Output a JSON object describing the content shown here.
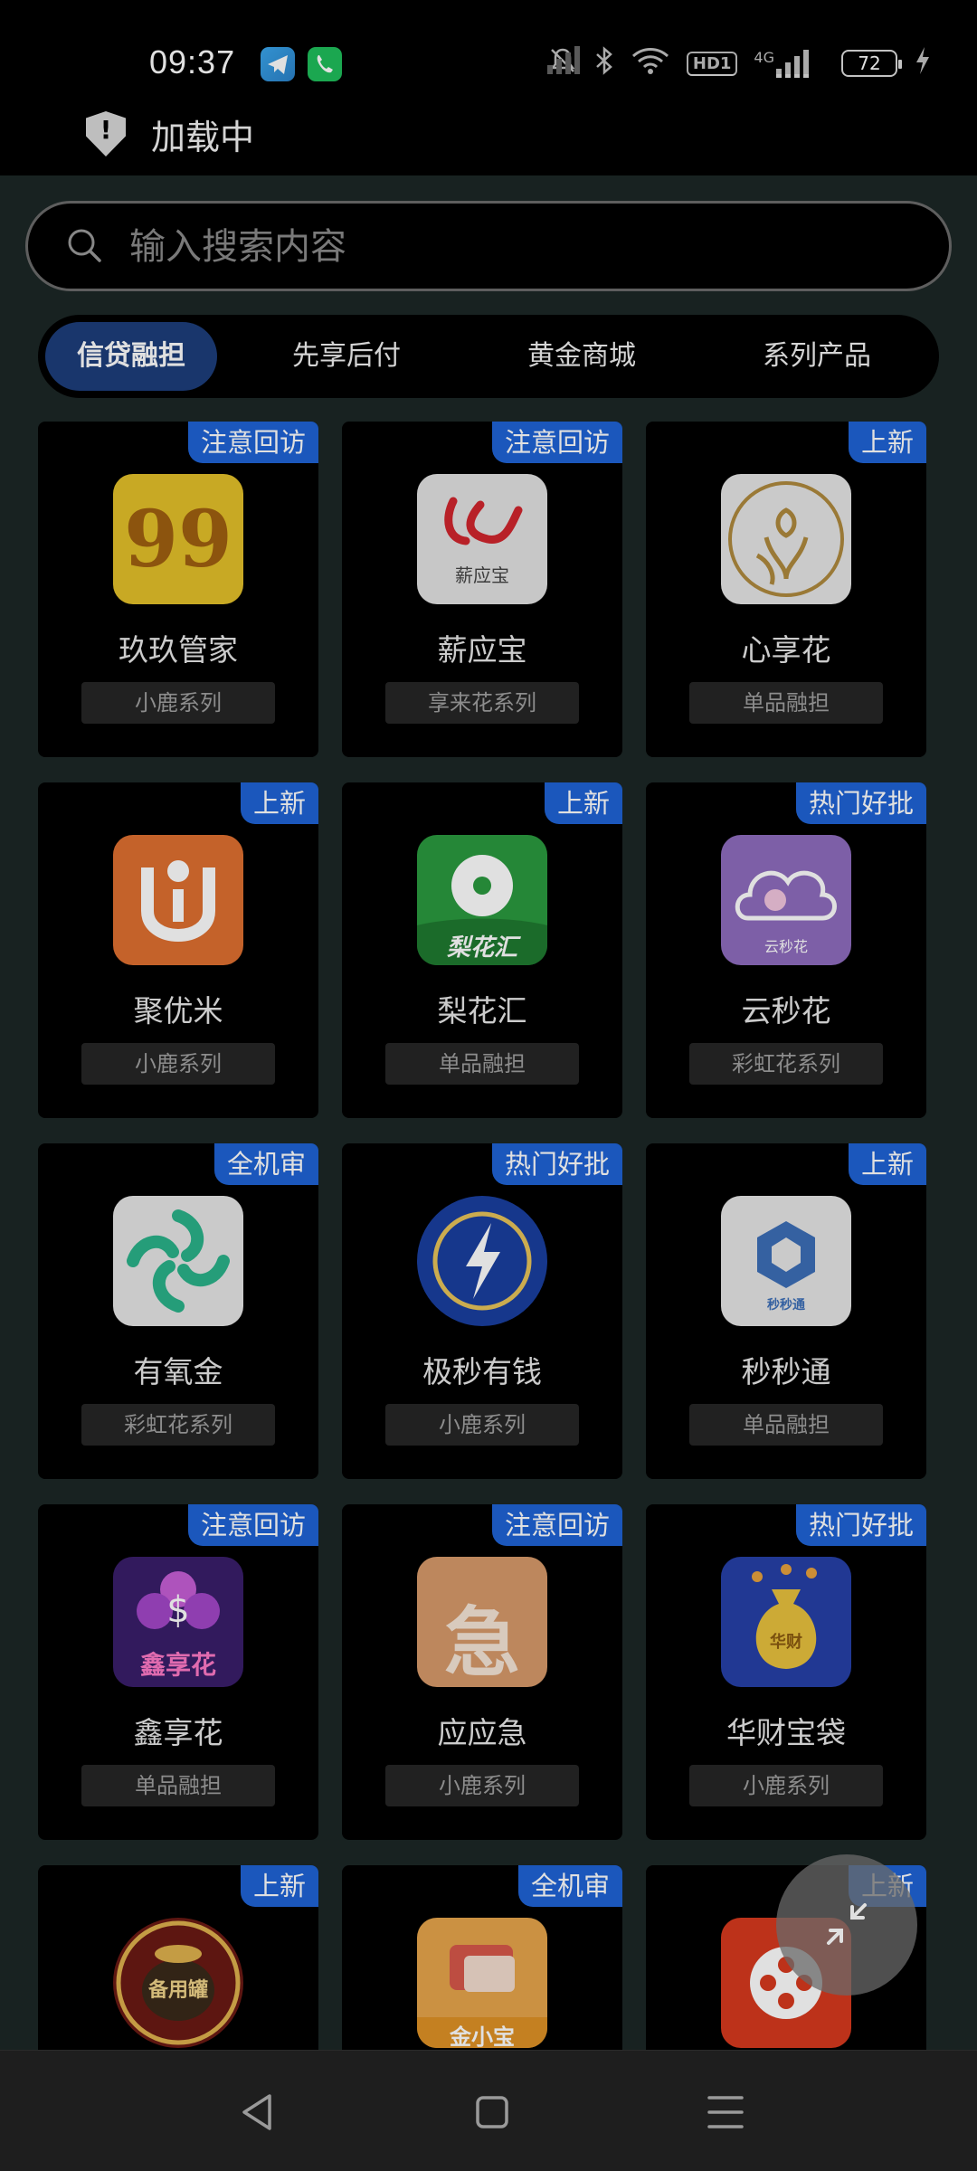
{
  "status_bar": {
    "time": "09:37",
    "network_label": "4G",
    "hd_label": "HD1",
    "battery": "72",
    "icons": [
      "telegram-icon",
      "phone-icon",
      "mute-icon",
      "bluetooth-icon",
      "wifi-icon",
      "hd-icon",
      "signal-icon",
      "signal-icon-2",
      "battery-icon",
      "charging-icon"
    ]
  },
  "page_loading": {
    "text": "加载中",
    "icon": "shield-icon"
  },
  "search": {
    "placeholder": "输入搜索内容",
    "value": ""
  },
  "tabs": [
    {
      "label": "信贷融担",
      "active": true
    },
    {
      "label": "先享后付",
      "active": false
    },
    {
      "label": "黄金商城",
      "active": false
    },
    {
      "label": "系列产品",
      "active": false
    }
  ],
  "products": [
    {
      "tag": "注意回访",
      "name": "玖玖管家",
      "series": "小鹿系列",
      "icon": "99-logo-icon",
      "icon_text": "99"
    },
    {
      "tag": "注意回访",
      "name": "薪应宝",
      "series": "享来花系列",
      "icon": "xinyingbao-logo-icon",
      "icon_text": "薪应宝"
    },
    {
      "tag": "上新",
      "name": "心享花",
      "series": "单品融担",
      "icon": "flower-logo-icon",
      "icon_text": ""
    },
    {
      "tag": "上新",
      "name": "聚优米",
      "series": "小鹿系列",
      "icon": "u-logo-icon",
      "icon_text": ""
    },
    {
      "tag": "上新",
      "name": "梨花汇",
      "series": "单品融担",
      "icon": "pear-blossom-logo-icon",
      "icon_text": "梨花汇"
    },
    {
      "tag": "热门好批",
      "name": "云秒花",
      "series": "彩虹花系列",
      "icon": "cloud-logo-icon",
      "icon_text": "云秒花"
    },
    {
      "tag": "全机审",
      "name": "有氧金",
      "series": "彩虹花系列",
      "icon": "swirl-logo-icon",
      "icon_text": ""
    },
    {
      "tag": "热门好批",
      "name": "极秒有钱",
      "series": "小鹿系列",
      "icon": "lightning-logo-icon",
      "icon_text": ""
    },
    {
      "tag": "上新",
      "name": "秒秒通",
      "series": "单品融担",
      "icon": "cube-logo-icon",
      "icon_text": "秒秒通"
    },
    {
      "tag": "注意回访",
      "name": "鑫享花",
      "series": "单品融担",
      "icon": "orchid-logo-icon",
      "icon_text": "鑫享花"
    },
    {
      "tag": "注意回访",
      "name": "应应急",
      "series": "小鹿系列",
      "icon": "ji-logo-icon",
      "icon_text": "急"
    },
    {
      "tag": "热门好批",
      "name": "华财宝袋",
      "series": "小鹿系列",
      "icon": "money-bag-logo-icon",
      "icon_text": "华财"
    },
    {
      "tag": "上新",
      "name": "",
      "series": "",
      "icon": "jar-logo-icon",
      "icon_text": "备用罐"
    },
    {
      "tag": "全机审",
      "name": "",
      "series": "",
      "icon": "wallet-logo-icon",
      "icon_text": "金小宝"
    },
    {
      "tag": "上新",
      "name": "",
      "series": "",
      "icon": "film-reel-logo-icon",
      "icon_text": ""
    }
  ],
  "fab": {
    "icon": "collapse-arrows-icon"
  },
  "nav": {
    "icons": [
      "back-icon",
      "home-icon",
      "menu-icon"
    ]
  }
}
